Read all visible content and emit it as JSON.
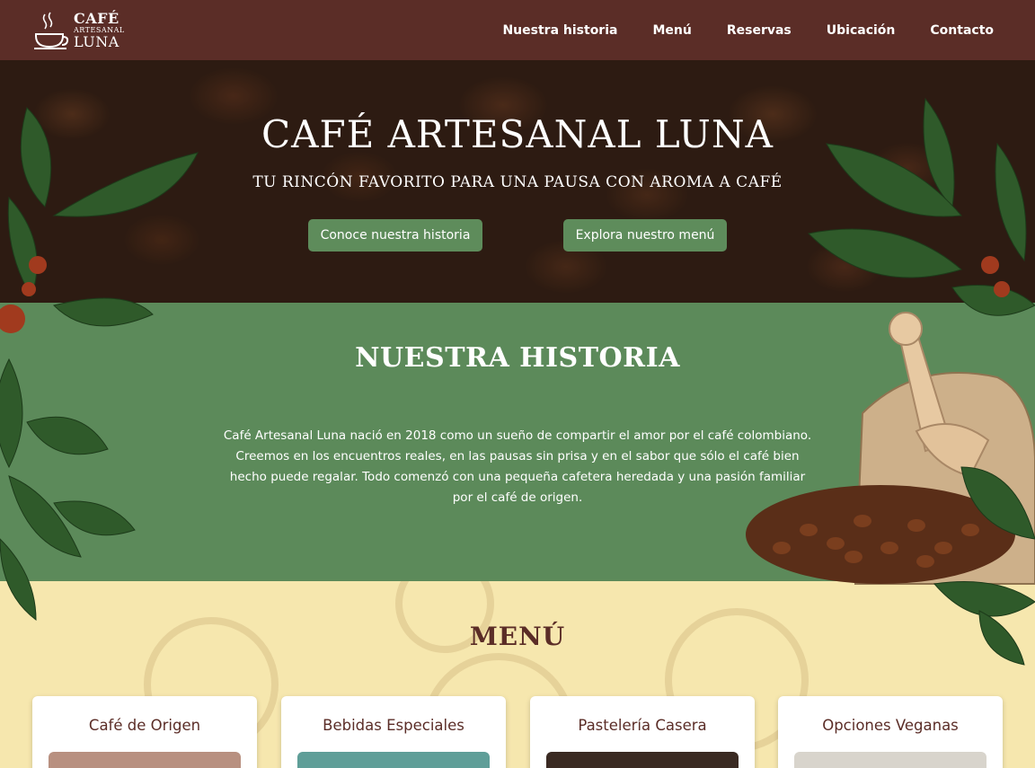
{
  "brand": {
    "line1": "CAFÉ",
    "line2": "ARTESANAL",
    "line3": "LUNA"
  },
  "nav": [
    "Nuestra historia",
    "Menú",
    "Reservas",
    "Ubicación",
    "Contacto"
  ],
  "hero": {
    "title": "CAFÉ ARTESANAL LUNA",
    "subtitle": "TU RINCÓN FAVORITO PARA UNA PAUSA CON AROMA A CAFÉ",
    "btn_story": "Conoce nuestra historia",
    "btn_menu": "Explora nuestro menú"
  },
  "historia": {
    "title": "NUESTRA HISTORIA",
    "text": "Café Artesanal Luna nació en 2018 como un sueño de compartir el amor por el café colombiano. Creemos en los encuentros reales, en las pausas sin prisa y en el sabor que sólo el café bien hecho puede regalar. Todo comenzó con una pequeña cafetera heredada y una pasión familiar por el café de origen."
  },
  "menu": {
    "title": "MENÚ",
    "cards": [
      "Café de Origen",
      "Bebidas Especiales",
      "Pastelería Casera",
      "Opciones Veganas"
    ]
  },
  "colors": {
    "navbar": "#5b2d27",
    "green": "#5c8a5a",
    "button": "#5e8c5b",
    "cream": "#f6e7ae"
  }
}
